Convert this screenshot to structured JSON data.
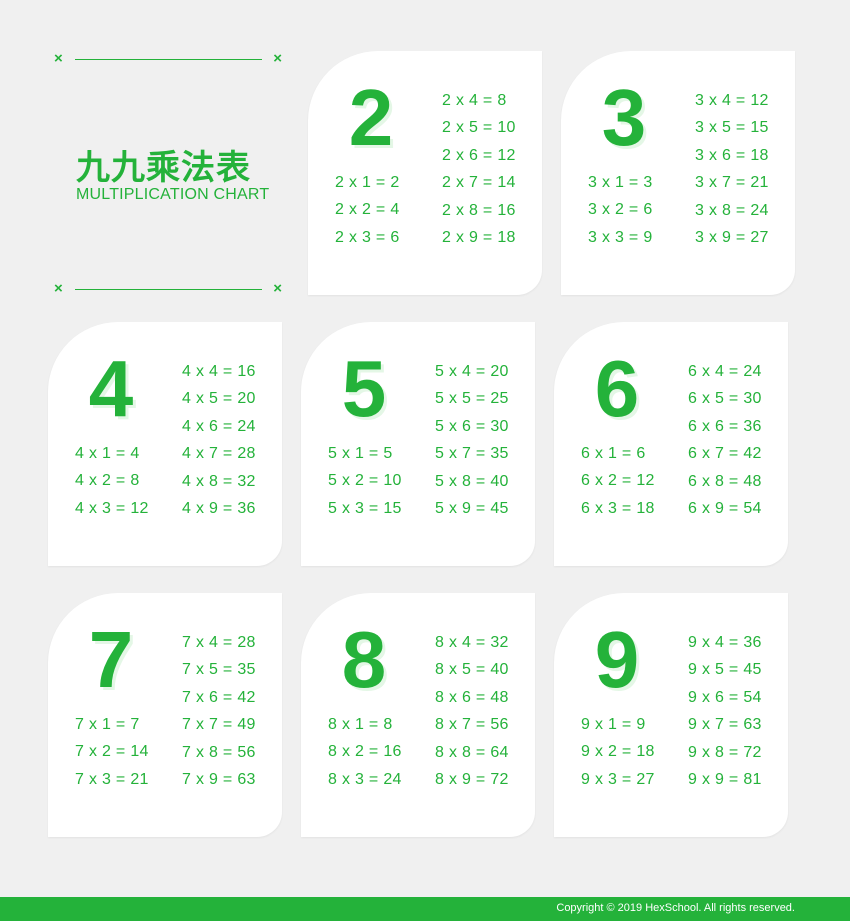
{
  "header": {
    "mark": "×",
    "title_cn": "九九乘法表",
    "title_en": "MULTIPLICATION CHART"
  },
  "cards": [
    {
      "number": "2",
      "left": [
        "2 x 1 = 2",
        "2 x 2 = 4",
        "2 x 3 = 6"
      ],
      "right": [
        "2 x 4 = 8",
        "2 x 5 = 10",
        "2 x 6 = 12",
        "2 x 7 = 14",
        "2 x 8 = 16",
        "2 x 9 = 18"
      ]
    },
    {
      "number": "3",
      "left": [
        "3 x 1 = 3",
        "3 x 2 = 6",
        "3 x 3 = 9"
      ],
      "right": [
        "3 x 4 = 12",
        "3 x 5 = 15",
        "3 x 6 = 18",
        "3 x 7 = 21",
        "3 x 8 = 24",
        "3 x 9 = 27"
      ]
    },
    {
      "number": "4",
      "left": [
        "4 x 1 = 4",
        "4 x 2 = 8",
        "4 x 3 = 12"
      ],
      "right": [
        "4 x 4 = 16",
        "4 x 5 = 20",
        "4 x 6 = 24",
        "4 x 7 = 28",
        "4 x 8 = 32",
        "4 x 9 = 36"
      ]
    },
    {
      "number": "5",
      "left": [
        "5 x 1 = 5",
        "5 x 2 = 10",
        "5 x 3 = 15"
      ],
      "right": [
        "5 x 4 = 20",
        "5 x 5 = 25",
        "5 x 6 = 30",
        "5 x 7 = 35",
        "5 x 8 = 40",
        "5 x 9 = 45"
      ]
    },
    {
      "number": "6",
      "left": [
        "6 x 1 = 6",
        "6 x 2 = 12",
        "6 x 3 = 18"
      ],
      "right": [
        "6 x 4 = 24",
        "6 x 5 = 30",
        "6 x 6 = 36",
        "6 x 7 = 42",
        "6 x 8 = 48",
        "6 x 9 = 54"
      ]
    },
    {
      "number": "7",
      "left": [
        "7 x 1 = 7",
        "7 x 2 = 14",
        "7 x 3 = 21"
      ],
      "right": [
        "7 x 4 = 28",
        "7 x 5 = 35",
        "7 x 6 = 42",
        "7 x 7 = 49",
        "7 x 8 = 56",
        "7 x 9 = 63"
      ]
    },
    {
      "number": "8",
      "left": [
        "8 x 1 = 8",
        "8 x 2 = 16",
        "8 x 3 = 24"
      ],
      "right": [
        "8 x 4 = 32",
        "8 x 5 = 40",
        "8 x 6 = 48",
        "8 x 7 = 56",
        "8 x 8 = 64",
        "8 x 9 = 72"
      ]
    },
    {
      "number": "9",
      "left": [
        "9 x 1 = 9",
        "9 x 2 = 18",
        "9 x 3 = 27"
      ],
      "right": [
        "9 x 4 = 36",
        "9 x 5 = 45",
        "9 x 6 = 54",
        "9 x 7 = 63",
        "9 x 8 = 72",
        "9 x 9 = 81"
      ]
    }
  ],
  "footer": {
    "copyright": "Copyright © 2019 HexSchool. All rights reserved."
  },
  "colors": {
    "accent": "#24b23a",
    "background": "#f0f0f0",
    "card": "#ffffff"
  }
}
